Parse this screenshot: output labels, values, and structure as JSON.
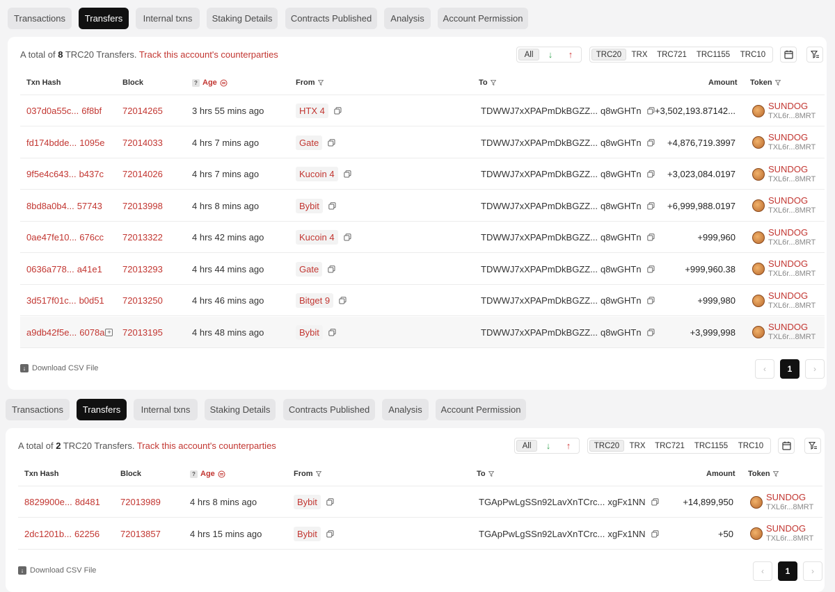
{
  "tabs": [
    "Transactions",
    "Transfers",
    "Internal txns",
    "Staking Details",
    "Contracts Published",
    "Analysis",
    "Account Permission"
  ],
  "active_tab": "Transfers",
  "filters": {
    "direction": [
      "All",
      "↓",
      "↑"
    ],
    "token_types": [
      "TRC20",
      "TRX",
      "TRC721",
      "TRC1155",
      "TRC10"
    ],
    "selected_token_type": "TRC20"
  },
  "icons": {
    "calendar": "calendar-icon",
    "filter_clear": "filter-clear-icon",
    "copy": "copy-icon",
    "funnel": "funnel-icon",
    "token_logo": "sundog-token-icon",
    "download": "download-icon"
  },
  "colors": {
    "accent_red": "#c23631",
    "active_tab_bg": "#111111",
    "in_arrow": "#3aa655",
    "out_arrow": "#d23c3c"
  },
  "columns": {
    "txn_hash": "Txn Hash",
    "block": "Block",
    "age": "Age",
    "from": "From",
    "to": "To",
    "amount": "Amount",
    "token": "Token"
  },
  "age_help": "?",
  "download_label": "Download CSV File",
  "pagination": {
    "prev": "‹",
    "page": "1",
    "next": "›"
  },
  "panels": [
    {
      "summary_prefix": "A total of",
      "count": "8",
      "summary_suffix": "TRC20 Transfers.",
      "track_label": "Track this account's counterparties",
      "rows": [
        {
          "hash_a": "037d0a55c...",
          "hash_b": "6f8bf",
          "block": "72014265",
          "age": "3 hrs 55 mins ago",
          "from": "HTX 4",
          "to_a": "TDWWJ7xXPAPmDkBGZZ...",
          "to_b": "q8wGHTn",
          "amount": "+3,502,193.87142...",
          "token": "SUNDOG",
          "token_addr": "TXL6r...8MRT"
        },
        {
          "hash_a": "fd174bdde...",
          "hash_b": "1095e",
          "block": "72014033",
          "age": "4 hrs 7 mins ago",
          "from": "Gate",
          "to_a": "TDWWJ7xXPAPmDkBGZZ...",
          "to_b": "q8wGHTn",
          "amount": "+4,876,719.3997",
          "token": "SUNDOG",
          "token_addr": "TXL6r...8MRT"
        },
        {
          "hash_a": "9f5e4c643...",
          "hash_b": "b437c",
          "block": "72014026",
          "age": "4 hrs 7 mins ago",
          "from": "Kucoin 4",
          "to_a": "TDWWJ7xXPAPmDkBGZZ...",
          "to_b": "q8wGHTn",
          "amount": "+3,023,084.0197",
          "token": "SUNDOG",
          "token_addr": "TXL6r...8MRT"
        },
        {
          "hash_a": "8bd8a0b4...",
          "hash_b": "57743",
          "block": "72013998",
          "age": "4 hrs 8 mins ago",
          "from": "Bybit",
          "to_a": "TDWWJ7xXPAPmDkBGZZ...",
          "to_b": "q8wGHTn",
          "amount": "+6,999,988.0197",
          "token": "SUNDOG",
          "token_addr": "TXL6r...8MRT"
        },
        {
          "hash_a": "0ae47fe10...",
          "hash_b": "676cc",
          "block": "72013322",
          "age": "4 hrs 42 mins ago",
          "from": "Kucoin 4",
          "to_a": "TDWWJ7xXPAPmDkBGZZ...",
          "to_b": "q8wGHTn",
          "amount": "+999,960",
          "token": "SUNDOG",
          "token_addr": "TXL6r...8MRT"
        },
        {
          "hash_a": "0636a778...",
          "hash_b": "a41e1",
          "block": "72013293",
          "age": "4 hrs 44 mins ago",
          "from": "Gate",
          "to_a": "TDWWJ7xXPAPmDkBGZZ...",
          "to_b": "q8wGHTn",
          "amount": "+999,960.38",
          "token": "SUNDOG",
          "token_addr": "TXL6r...8MRT"
        },
        {
          "hash_a": "3d517f01c...",
          "hash_b": "b0d51",
          "block": "72013250",
          "age": "4 hrs 46 mins ago",
          "from": "Bitget 9",
          "to_a": "TDWWJ7xXPAPmDkBGZZ...",
          "to_b": "q8wGHTn",
          "amount": "+999,980",
          "token": "SUNDOG",
          "token_addr": "TXL6r...8MRT"
        },
        {
          "hash_a": "a9db42f5e...",
          "hash_b": "6078a",
          "block": "72013195",
          "age": "4 hrs 48 mins ago",
          "from": "Bybit",
          "to_a": "TDWWJ7xXPAPmDkBGZZ...",
          "to_b": "q8wGHTn",
          "amount": "+3,999,998",
          "token": "SUNDOG",
          "token_addr": "TXL6r...8MRT"
        }
      ]
    },
    {
      "summary_prefix": "A total of",
      "count": "2",
      "summary_suffix": "TRC20 Transfers.",
      "track_label": "Track this account's counterparties",
      "rows": [
        {
          "hash_a": "8829900e...",
          "hash_b": "8d481",
          "block": "72013989",
          "age": "4 hrs 8 mins ago",
          "from": "Bybit",
          "to_a": "TGApPwLgSSn92LavXnTCrc...",
          "to_b": "xgFx1NN",
          "amount": "+14,899,950",
          "token": "SUNDOG",
          "token_addr": "TXL6r...8MRT"
        },
        {
          "hash_a": "2dc1201b...",
          "hash_b": "62256",
          "block": "72013857",
          "age": "4 hrs 15 mins ago",
          "from": "Bybit",
          "to_a": "TGApPwLgSSn92LavXnTCrc...",
          "to_b": "xgFx1NN",
          "amount": "+50",
          "token": "SUNDOG",
          "token_addr": "TXL6r...8MRT"
        }
      ]
    }
  ]
}
